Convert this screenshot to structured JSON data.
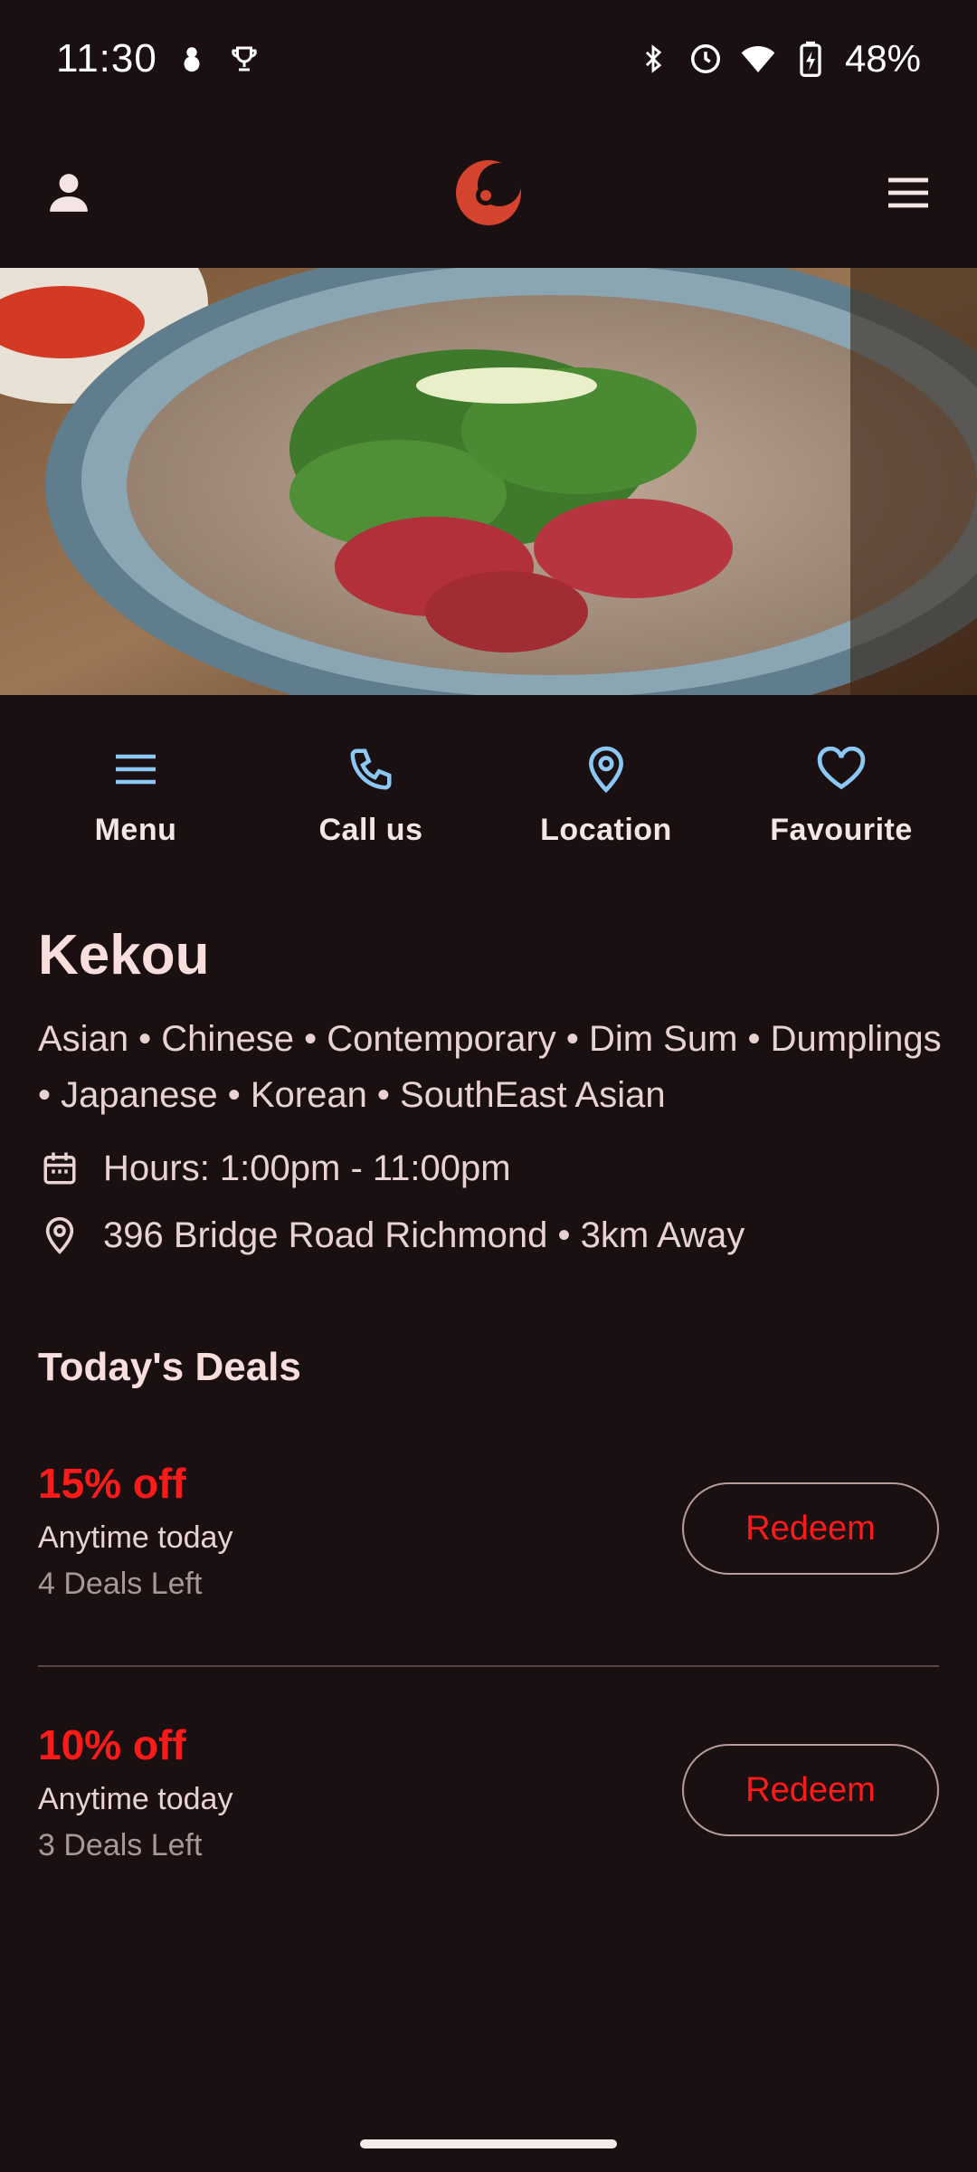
{
  "status_bar": {
    "time": "11:30",
    "battery": "48%"
  },
  "actions": [
    {
      "label": "Menu",
      "icon": "menu-lines-icon"
    },
    {
      "label": "Call us",
      "icon": "phone-icon"
    },
    {
      "label": "Location",
      "icon": "location-pin-icon"
    },
    {
      "label": "Favourite",
      "icon": "heart-icon"
    }
  ],
  "restaurant": {
    "name": "Kekou",
    "cuisines": "Asian • Chinese • Contemporary • Dim Sum • Dumplings • Japanese • Korean • SouthEast Asian",
    "hours": "Hours: 1:00pm - 11:00pm",
    "address": "396 Bridge Road Richmond • 3km Away"
  },
  "deals": {
    "title": "Today's Deals",
    "items": [
      {
        "discount": "15% off",
        "when": "Anytime today",
        "left": "4 Deals Left",
        "button": "Redeem"
      },
      {
        "discount": "10% off",
        "when": "Anytime today",
        "left": "3 Deals Left",
        "button": "Redeem"
      }
    ]
  },
  "colors": {
    "background": "#1b1011",
    "accent_blue": "#8cc8f5",
    "deal_red": "#ff1a1a",
    "logo": "#d4432e"
  }
}
